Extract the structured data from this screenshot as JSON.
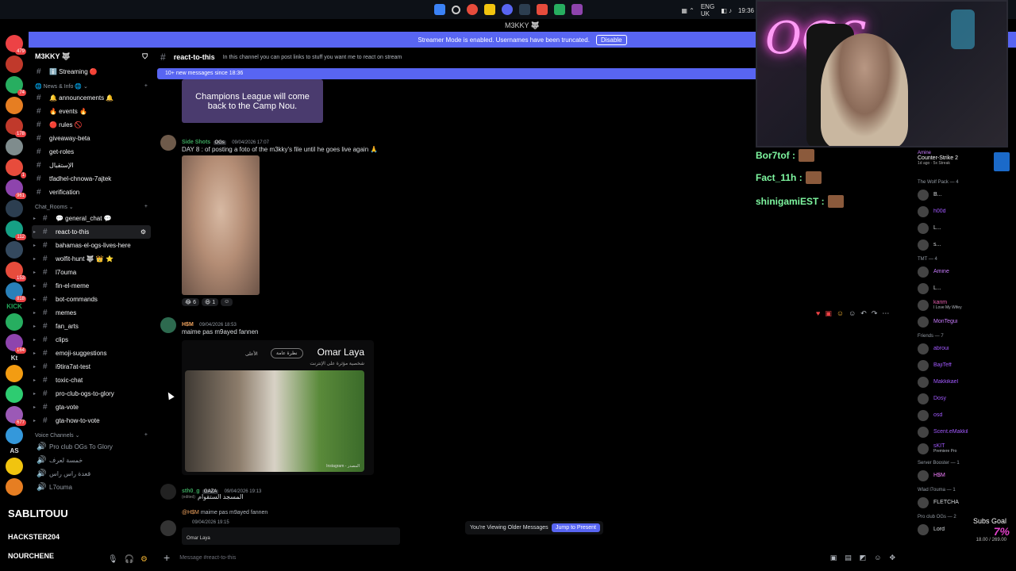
{
  "window": {
    "title": "M3KKY 🐺"
  },
  "taskbar": {
    "lang": "ENG",
    "region": "UK",
    "time": "19:36"
  },
  "banner": {
    "text": "Streamer Mode is enabled. Usernames have been truncated.",
    "button": "Disable"
  },
  "server": {
    "name": "M3KKY 🐺"
  },
  "server_rail": [
    {
      "color": "#ed4245",
      "badge": "479"
    },
    {
      "color": "#c0392b",
      "badge": ""
    },
    {
      "color": "#27ae60",
      "badge": "74"
    },
    {
      "color": "#e67e22",
      "badge": ""
    },
    {
      "color": "#c0392b",
      "badge": "178"
    },
    {
      "color": "#7f8c8d",
      "badge": ""
    },
    {
      "color": "#e74c3c",
      "badge": "1"
    },
    {
      "color": "#8e44ad",
      "badge": "961"
    },
    {
      "color": "#2c3e50",
      "badge": ""
    },
    {
      "color": "#16a085",
      "badge": "112"
    },
    {
      "color": "#34495e",
      "badge": ""
    },
    {
      "color": "#e74c3c",
      "badge": "153"
    },
    {
      "color": "#2980b9",
      "badge": "818"
    },
    {
      "color": "#27ae60",
      "badge": ""
    },
    {
      "color": "#8e44ad",
      "badge": "164"
    },
    {
      "color": "#f39c12",
      "badge": ""
    },
    {
      "color": "#2ecc71",
      "badge": ""
    },
    {
      "color": "#9b59b6",
      "badge": "677"
    },
    {
      "color": "#3498db",
      "badge": ""
    },
    {
      "color": "#f1c40f",
      "badge": ""
    },
    {
      "color": "#e67e22",
      "badge": ""
    }
  ],
  "server_rail_text": {
    "kick": "KICK",
    "kt": "Kt",
    "as": "AS"
  },
  "channels": {
    "top": [
      {
        "label": "ℹ️ Streaming 🔴"
      }
    ],
    "categories": [
      {
        "name": "🌐 News & Info 🌐",
        "items": [
          {
            "label": "🔔 announcements 🔔"
          },
          {
            "label": "🔥 events 🔥"
          },
          {
            "label": "🔴 rules 🚫"
          },
          {
            "label": "giveaway-beta"
          },
          {
            "label": "get-roles"
          },
          {
            "label": "الإستقبال"
          },
          {
            "label": "tfadhel-chnowa-7ajtek"
          },
          {
            "label": "verification"
          }
        ]
      },
      {
        "name": "Chat_Rooms",
        "items": [
          {
            "label": "💬 general_chat 💬"
          },
          {
            "label": "react-to-this",
            "active": true
          },
          {
            "label": "bahamas-el-ogs-lives-here"
          },
          {
            "label": "wolfit-hunt 🐺 👑 ⭐"
          },
          {
            "label": "l7ouma"
          },
          {
            "label": "fin-el-meme"
          },
          {
            "label": "bot-commands"
          },
          {
            "label": "memes"
          },
          {
            "label": "fan_arts"
          },
          {
            "label": "clips"
          },
          {
            "label": "emoji-suggestions"
          },
          {
            "label": "i9tira7at-test"
          },
          {
            "label": "toxic-chat"
          },
          {
            "label": "pro-club-ogs-to-glory"
          },
          {
            "label": "gta-vote"
          },
          {
            "label": "gta-how-to-vote"
          }
        ]
      },
      {
        "name": "Voice Channels",
        "items": [
          {
            "label": "Pro club OGs To Glory"
          },
          {
            "label": "خمسة لعرف"
          },
          {
            "label": "قعدة راس راس"
          },
          {
            "label": "L7ouma"
          }
        ]
      }
    ]
  },
  "header": {
    "channel": "react-to-this",
    "topic": "In this channel you can post links to stuff you want me to react on stream",
    "new_messages": "10+ new messages since 18:36"
  },
  "messages": [
    {
      "image_caption": "Champions League will come back to the Camp Nou."
    },
    {
      "author": "Side Shots",
      "tag": "OGs",
      "timestamp": "09/04/2026 17:07",
      "text": "DAY 8 : of posting a foto of the m3kky's file until he goes live again 🙏",
      "reactions": [
        "😂 6",
        "😆 1",
        "☺"
      ]
    },
    {
      "author": "H$M",
      "timestamp": "09/04/2026 18:53",
      "text": "maime pas m9ayed fannen",
      "card_title": "Omar Laya",
      "card_subtitle": "شخصية مؤثرة على الإنترنت",
      "card_chip1": "الأعلى",
      "card_chip2": "نظرة عامة",
      "card_credit": "Instagram - المصدر"
    },
    {
      "author": "sth0_g",
      "tag": "GAZA",
      "timestamp": "09/04/2026 19:13",
      "subtag": "(edited)",
      "text": "المسجد الستقوام",
      "reply_author": "@H$M",
      "reply_text": "maime pas m9ayed fannen",
      "reply_time": "09/04/2026 19:15",
      "embed_title": "Omar Laya"
    }
  ],
  "viewing_older": {
    "label": "You're Viewing Older Messages",
    "button": "Jump to Present"
  },
  "composer": {
    "placeholder": "Message #react-to-this"
  },
  "members": {
    "top_activity": {
      "name": "Amine",
      "game": "Counter-Strike 2",
      "detail": "1d ago · 5x Streak"
    },
    "groups": [
      {
        "name": "The Wolf Pack — 4",
        "members": [
          {
            "name": "B...",
            "color": "#dbdee1"
          },
          {
            "name": "h00d",
            "color": "#a259ff"
          },
          {
            "name": "L...",
            "color": "#dbdee1"
          },
          {
            "name": "s...",
            "color": "#dbdee1"
          }
        ]
      },
      {
        "name": "TMT — 4",
        "members": [
          {
            "name": "Amine",
            "color": "#c97cff"
          },
          {
            "name": "L...",
            "color": "#dbdee1"
          },
          {
            "name": "karim",
            "color": "#e85fb0",
            "status": "I Love My Wifey"
          },
          {
            "name": "MonTegui",
            "color": "#c97cff"
          }
        ]
      },
      {
        "name": "Friends — 7",
        "members": [
          {
            "name": "abroui",
            "color": "#a259ff"
          },
          {
            "name": "BajiTeff",
            "color": "#a259ff"
          },
          {
            "name": "Makkikael",
            "color": "#a259ff"
          },
          {
            "name": "Dosy",
            "color": "#a259ff"
          },
          {
            "name": "osd",
            "color": "#a259ff"
          },
          {
            "name": "Scent.eMakkil",
            "color": "#a259ff"
          },
          {
            "name": "sKIT",
            "color": "#a259ff",
            "status": "Premiere Pro"
          }
        ]
      },
      {
        "name": "Server Booster — 1",
        "members": [
          {
            "name": "H$M",
            "color": "#f47fff"
          }
        ]
      },
      {
        "name": "Wlad l7ouma — 1",
        "members": [
          {
            "name": "FLETCHA",
            "color": "#dbdee1"
          }
        ]
      },
      {
        "name": "Pro club OGs — 2",
        "members": [
          {
            "name": "Lord",
            "color": "#dbdee1"
          }
        ]
      }
    ]
  },
  "overlay_chat": [
    {
      "name": "Bor7tof :"
    },
    {
      "name": "Fact_11h :"
    },
    {
      "name": "shinigamiEST :"
    }
  ],
  "stream_overlay": {
    "title": "SABLITOUU",
    "sub1": "HACKSTER204",
    "sub2": "NOURCHENE"
  },
  "subs_goal": {
    "label": "Subs Goal",
    "percent": "7%",
    "progress": "18.00 / 269.00"
  },
  "colors": {
    "blurple": "#5865f2",
    "bg": "#000000"
  }
}
